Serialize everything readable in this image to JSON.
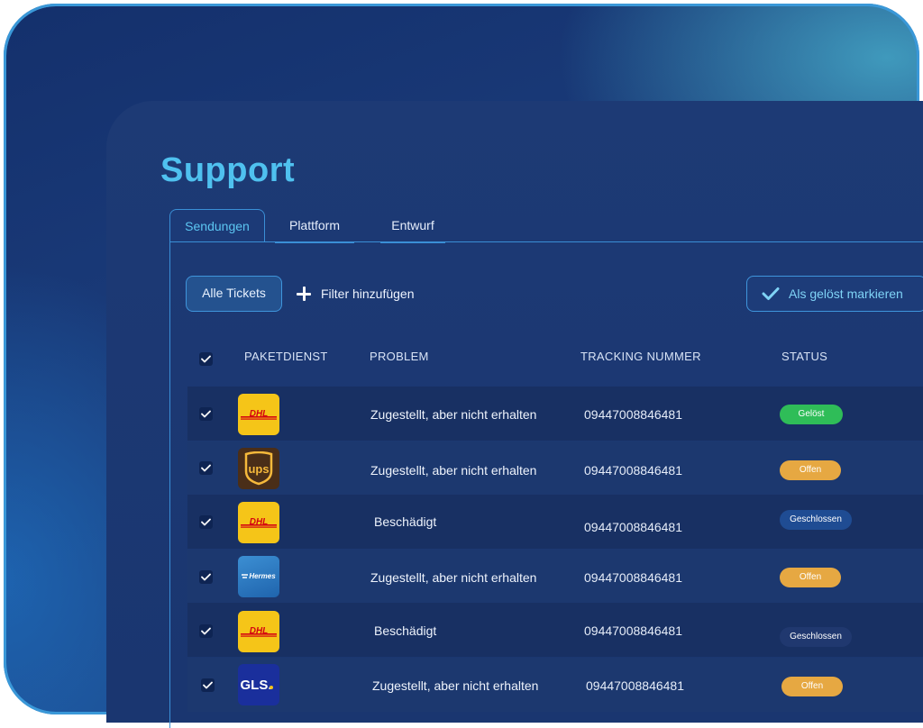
{
  "page": {
    "title": "Support"
  },
  "tabs": [
    {
      "label": "Sendungen",
      "active": true
    },
    {
      "label": "Plattform",
      "active": false
    },
    {
      "label": "Entwurf",
      "active": false
    }
  ],
  "toolbar": {
    "all_tickets": "Alle Tickets",
    "add_filter": "Filter hinzufügen",
    "mark_resolved": "Als gelöst markieren"
  },
  "table": {
    "headers": [
      "PAKETDIENST",
      "PROBLEM",
      "TRACKING NUMMER",
      "STATUS"
    ],
    "rows": [
      {
        "carrier": "DHL",
        "logo_text": "DHL",
        "problem": "Zugestellt, aber nicht erhalten",
        "tracking": "09447008846481",
        "status": "Gelöst",
        "status_color": "#2fbd58",
        "checked": true
      },
      {
        "carrier": "UPS",
        "logo_text": "ups",
        "problem": "Zugestellt, aber nicht erhalten",
        "tracking": "09447008846481",
        "status": "Offen",
        "status_color": "#e6a842",
        "checked": true
      },
      {
        "carrier": "DHL",
        "logo_text": "DHL",
        "problem": "Beschädigt",
        "tracking": "09447008846481",
        "status": "Geschlossen",
        "status_color": "#1f4c93",
        "checked": true
      },
      {
        "carrier": "Hermes",
        "logo_text": "Hermes",
        "problem": "Zugestellt, aber nicht erhalten",
        "tracking": "09447008846481",
        "status": "Offen",
        "status_color": "#e6a842",
        "checked": true
      },
      {
        "carrier": "DHL",
        "logo_text": "DHL",
        "problem": "Beschädigt",
        "tracking": "09447008846481",
        "status": "Geschlossen",
        "status_color": "#20386f",
        "checked": true
      },
      {
        "carrier": "GLS",
        "logo_text": "GLS.",
        "problem": "Zugestellt, aber nicht erhalten",
        "tracking": "09447008846481",
        "status": "Offen",
        "status_color": "#e6a842",
        "checked": true
      }
    ]
  },
  "colors": {
    "accent": "#4fc1ef",
    "border": "#3a8fd6",
    "dhl_yellow": "#f5c518",
    "dhl_red": "#d40511"
  }
}
